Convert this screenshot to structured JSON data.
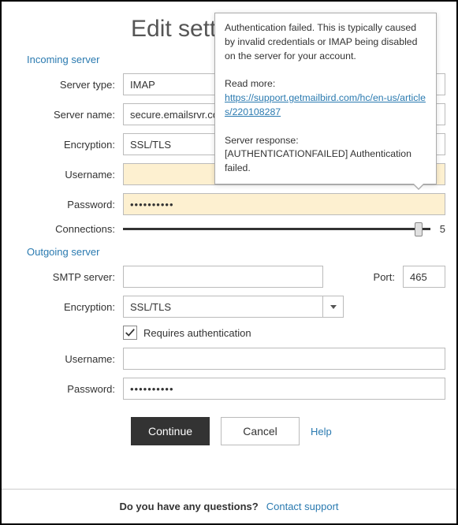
{
  "title": "Edit sett",
  "incoming": {
    "header": "Incoming server",
    "labels": {
      "server_type": "Server type:",
      "server_name": "Server name:",
      "encryption": "Encryption:",
      "username": "Username:",
      "password": "Password:",
      "connections": "Connections:"
    },
    "values": {
      "server_type": "IMAP",
      "server_name": "secure.emailsrvr.co",
      "encryption": "SSL/TLS",
      "username": "",
      "password": "••••••••••",
      "connections": "5"
    }
  },
  "outgoing": {
    "header": "Outgoing server",
    "labels": {
      "smtp_server": "SMTP server:",
      "port": "Port:",
      "encryption": "Encryption:",
      "requires_auth": "Requires authentication",
      "username": "Username:",
      "password": "Password:"
    },
    "values": {
      "smtp_server": "",
      "port": "465",
      "encryption": "SSL/TLS",
      "requires_auth_checked": true,
      "username": "",
      "password": "••••••••••"
    }
  },
  "buttons": {
    "continue": "Continue",
    "cancel": "Cancel",
    "help": "Help"
  },
  "footer": {
    "question": "Do you have any questions?",
    "link": "Contact support"
  },
  "tooltip": {
    "line1": "Authentication failed. This is typically caused by invalid credentials or IMAP being disabled on the server for your account.",
    "read_more": "Read more:",
    "link": "https://support.getmailbird.com/hc/en-us/articles/220108287",
    "server_response_label": "Server response:",
    "server_response": "[AUTHENTICATIONFAILED] Authentication failed."
  }
}
